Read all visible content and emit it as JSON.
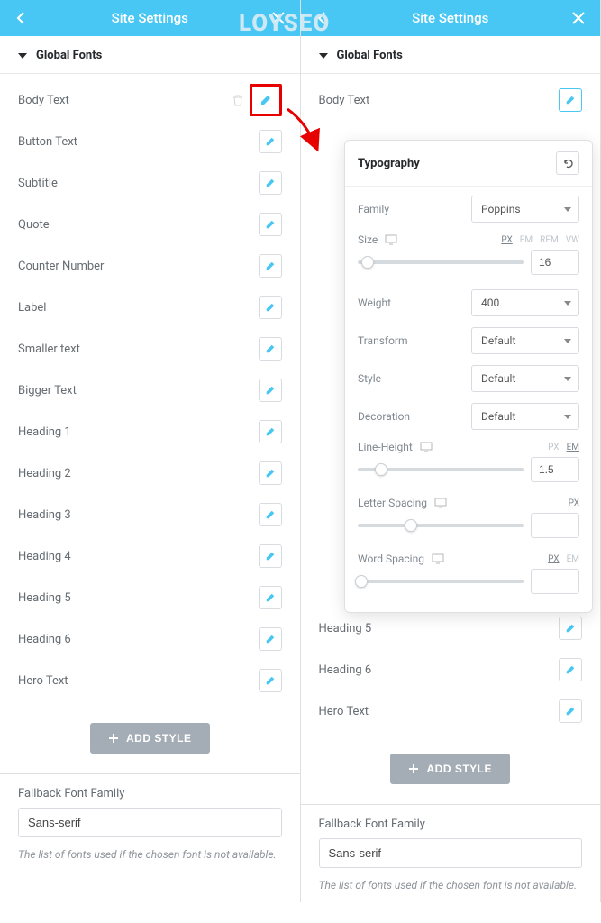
{
  "watermark": "LOYSEO",
  "header": {
    "title": "Site Settings"
  },
  "section": {
    "title": "Global Fonts"
  },
  "fonts": [
    "Body Text",
    "Button Text",
    "Subtitle",
    "Quote",
    "Counter Number",
    "Label",
    "Smaller text",
    "Bigger Text",
    "Heading 1",
    "Heading 2",
    "Heading 3",
    "Heading 4",
    "Heading 5",
    "Heading 6",
    "Hero Text"
  ],
  "add_style": "ADD STYLE",
  "fallback": {
    "label": "Fallback Font Family",
    "value": "Sans-serif",
    "help": "The list of fonts used if the chosen font is not available."
  },
  "panel2_fonts_visible": [
    "Body Text",
    "Heading 5",
    "Heading 6",
    "Hero Text"
  ],
  "typography": {
    "title": "Typography",
    "family_label": "Family",
    "family_value": "Poppins",
    "size_label": "Size",
    "size_value": "16",
    "size_units": [
      "PX",
      "EM",
      "REM",
      "VW"
    ],
    "size_active_unit": "PX",
    "weight_label": "Weight",
    "weight_value": "400",
    "transform_label": "Transform",
    "transform_value": "Default",
    "style_label": "Style",
    "style_value": "Default",
    "decoration_label": "Decoration",
    "decoration_value": "Default",
    "lineheight_label": "Line-Height",
    "lineheight_value": "1.5",
    "lineheight_units": [
      "PX",
      "EM"
    ],
    "lineheight_active_unit": "EM",
    "letterspacing_label": "Letter Spacing",
    "letterspacing_value": "",
    "letterspacing_units": [
      "PX"
    ],
    "wordspacing_label": "Word Spacing",
    "wordspacing_value": "",
    "wordspacing_units": [
      "PX",
      "EM"
    ],
    "wordspacing_active_unit": "PX"
  }
}
